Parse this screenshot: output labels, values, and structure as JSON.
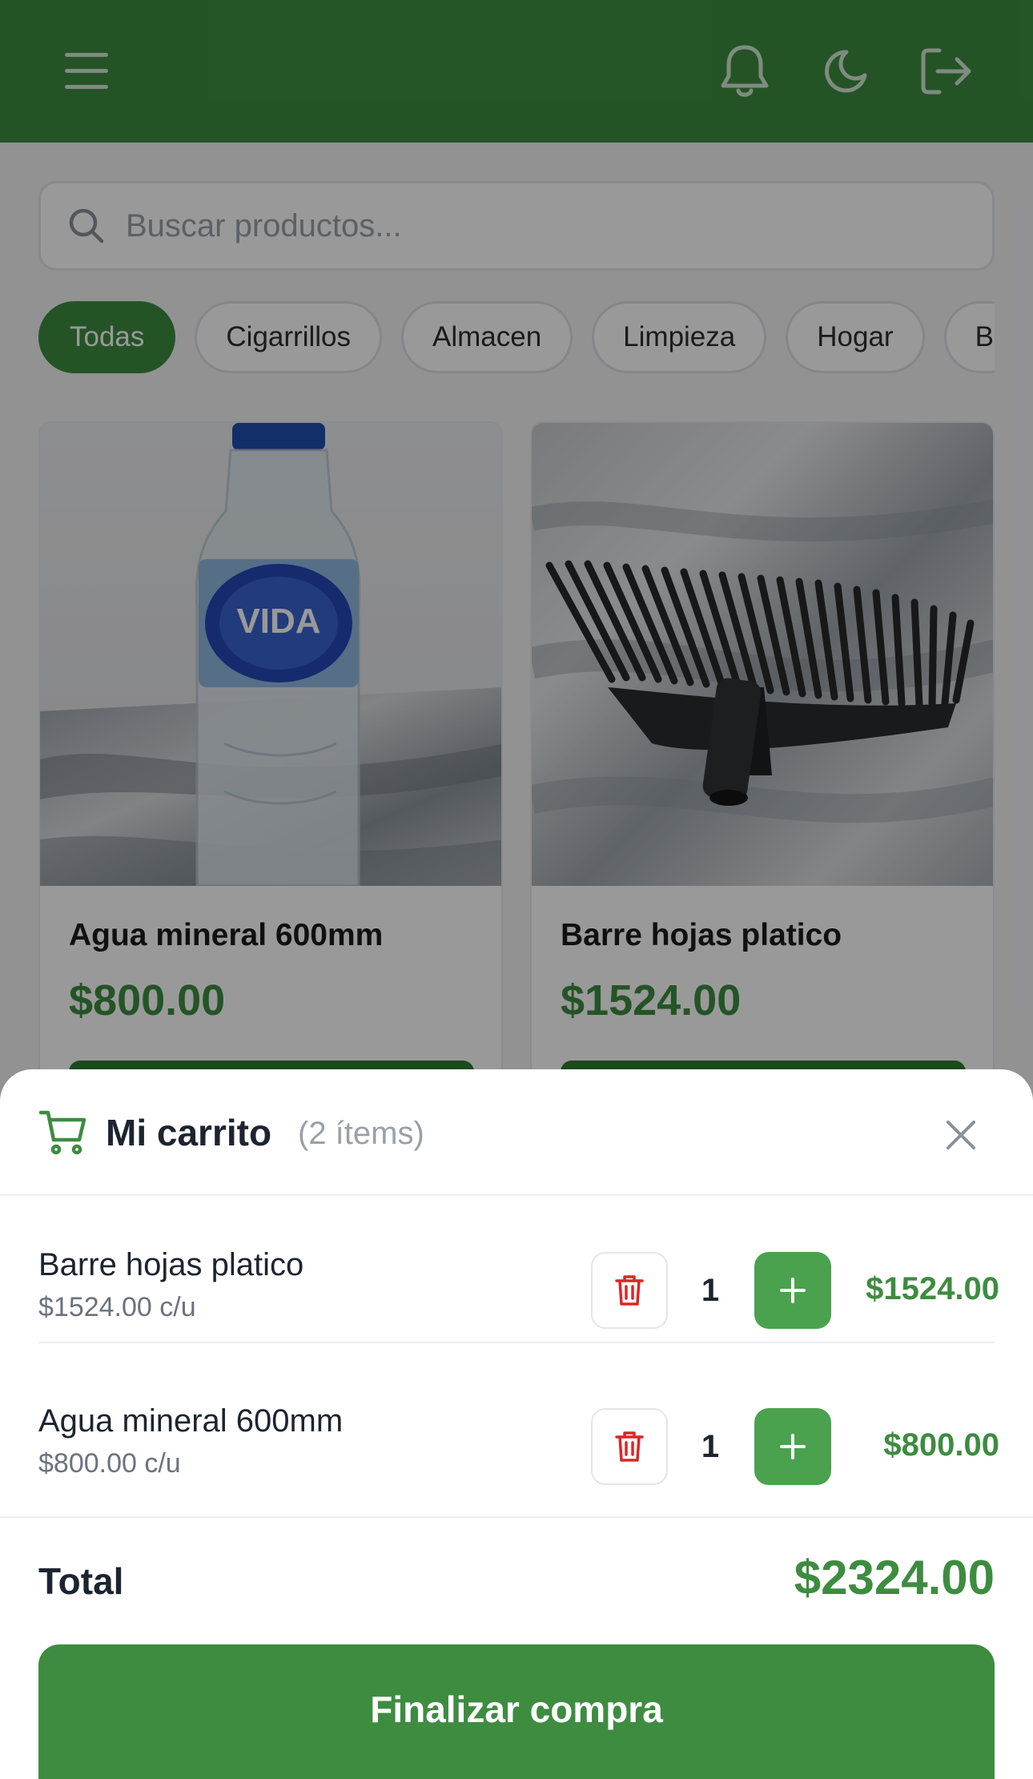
{
  "header": {
    "menu_icon": "hamburger-menu-icon",
    "bell_icon": "bell-icon",
    "theme_icon": "moon-icon",
    "logout_icon": "logout-icon",
    "bg_color": "#3d8c40"
  },
  "search": {
    "placeholder": "Buscar productos..."
  },
  "categories": {
    "items": [
      "Todas",
      "Cigarrillos",
      "Almacen",
      "Limpieza",
      "Hogar",
      "B"
    ],
    "selected": "Todas"
  },
  "products": [
    {
      "name": "Agua mineral 600mm",
      "price": "$800.00"
    },
    {
      "name": "Barre hojas platico",
      "price": "$1524.00"
    }
  ],
  "cart": {
    "title": "Mi carrito",
    "count": "(2 ítems)",
    "items": [
      {
        "name": "Barre hojas platico",
        "unit_price": "$1524.00 c/u",
        "qty": "1",
        "subtotal": "$1524.00"
      },
      {
        "name": "Agua mineral 600mm",
        "unit_price": "$800.00 c/u",
        "qty": "1",
        "subtotal": "$800.00"
      }
    ],
    "total_label": "Total",
    "total_value": "$2324.00",
    "checkout_label": "Finalizar compra"
  },
  "colors": {
    "accent": "#3d8c40",
    "plus_button": "#4aa24e",
    "danger": "#dc2626"
  }
}
